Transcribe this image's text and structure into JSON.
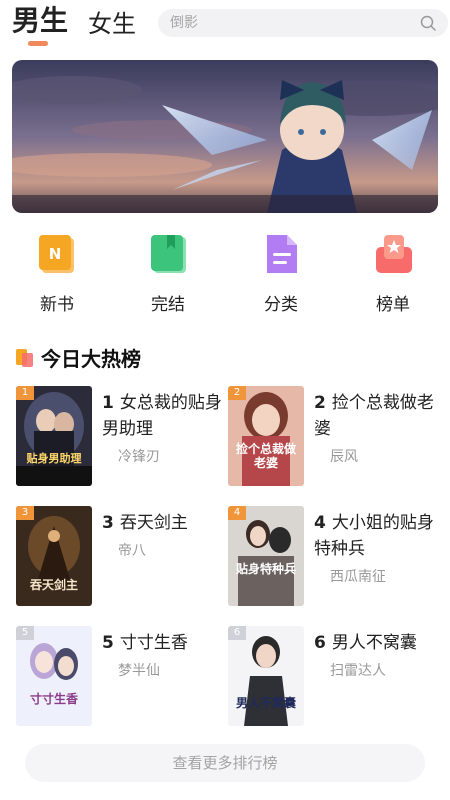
{
  "tabs": {
    "male": "男生",
    "female": "女生"
  },
  "search": {
    "placeholder": "倒影"
  },
  "shortcuts": [
    {
      "label": "新书",
      "icon": "new-book-icon",
      "color": "#f5a623"
    },
    {
      "label": "完结",
      "icon": "finished-book-icon",
      "color": "#3cc47c"
    },
    {
      "label": "分类",
      "icon": "category-doc-icon",
      "color": "#b27cf2"
    },
    {
      "label": "榜单",
      "icon": "ranking-icon",
      "color": "#f76b6b"
    }
  ],
  "section": {
    "title": "今日大热榜"
  },
  "books": [
    {
      "rank": "1",
      "title": "女总裁的贴身男助理",
      "author": "冷锋刃",
      "cover_text": "贴身男助理"
    },
    {
      "rank": "2",
      "title": "捡个总裁做老婆",
      "author": "辰风",
      "cover_text": "捡个总裁做老婆"
    },
    {
      "rank": "3",
      "title": "吞天剑主",
      "author": "帝八",
      "cover_text": "吞天剑主"
    },
    {
      "rank": "4",
      "title": "大小姐的贴身特种兵",
      "author": "西瓜南征",
      "cover_text": "贴身特种兵"
    },
    {
      "rank": "5",
      "title": "寸寸生香",
      "author": "梦半仙",
      "cover_text": "寸寸生香"
    },
    {
      "rank": "6",
      "title": "男人不窝囊",
      "author": "扫雷达人",
      "cover_text": "男人不窝囊"
    }
  ],
  "more_button": "查看更多排行榜",
  "colors": {
    "accent": "#f08a5d",
    "rank_badge": "#f0953a"
  }
}
